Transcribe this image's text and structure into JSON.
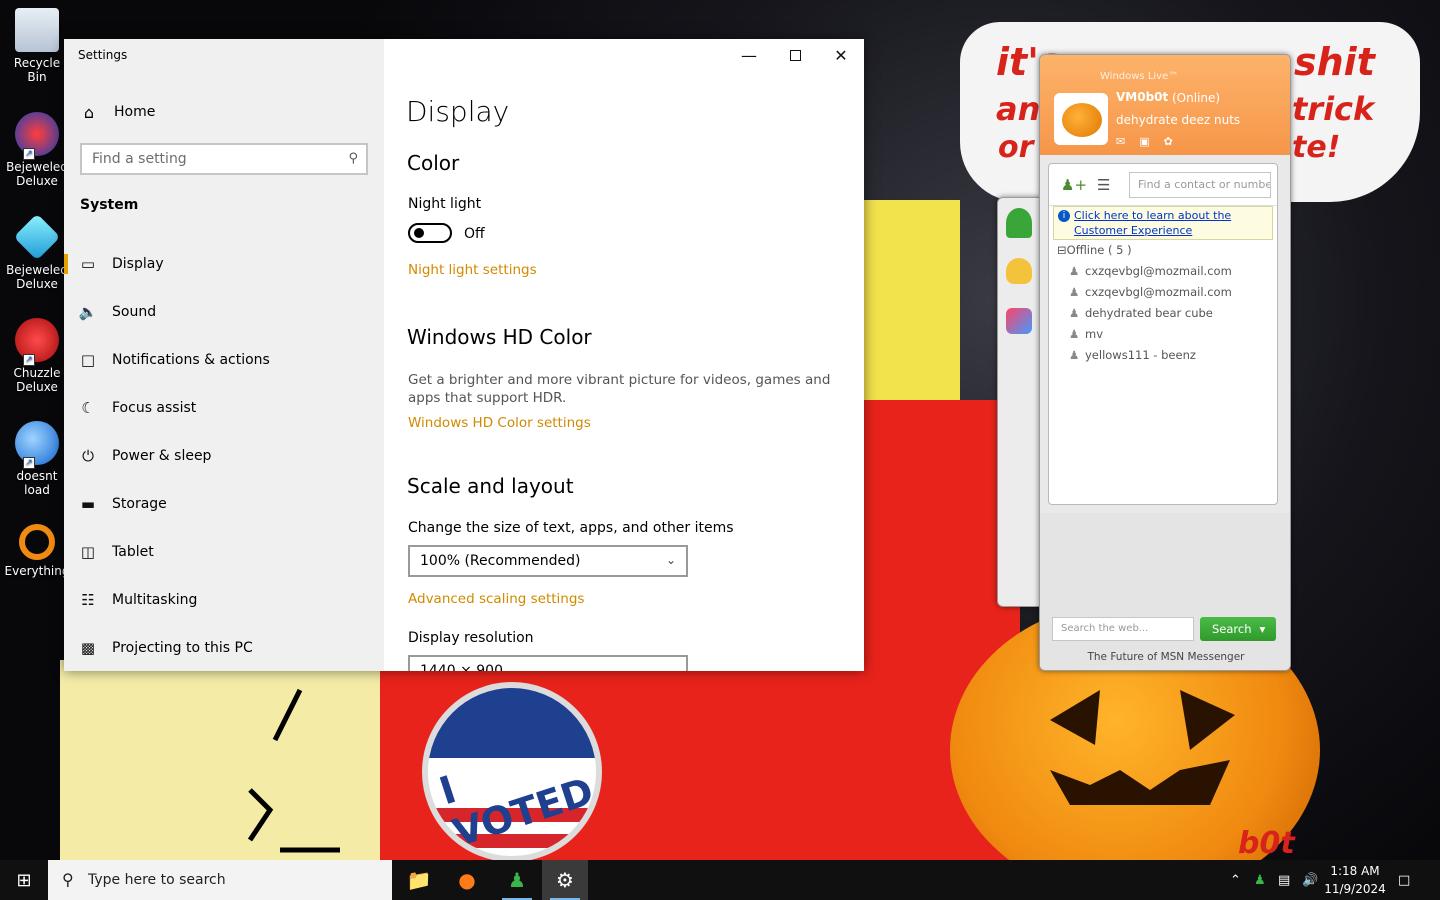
{
  "wallpaper": {
    "bubble_lines": [
      "it's",
      "shit",
      "an",
      "trick",
      "or",
      "te!"
    ],
    "badge_text": "I VOTED",
    "watermark": "b0t"
  },
  "desktop_icons": [
    {
      "label": "Recycle Bin",
      "icon": "recycle-bin-icon"
    },
    {
      "label": "Bejeweled Deluxe",
      "icon": "bejeweled2-icon"
    },
    {
      "label": "Bejeweled Deluxe",
      "icon": "bejeweled-gem-icon"
    },
    {
      "label": "Chuzzle Deluxe",
      "icon": "chuzzle-icon"
    },
    {
      "label": "doesnt load",
      "icon": "thunderbird-icon"
    },
    {
      "label": "Everything",
      "icon": "everything-search-icon"
    }
  ],
  "settings": {
    "window_title": "Settings",
    "home": "Home",
    "search_placeholder": "Find a setting",
    "section": "System",
    "nav": [
      {
        "label": "Display",
        "icon": "monitor-icon",
        "active": true
      },
      {
        "label": "Sound",
        "icon": "speaker-icon"
      },
      {
        "label": "Notifications & actions",
        "icon": "notification-icon"
      },
      {
        "label": "Focus assist",
        "icon": "moon-icon"
      },
      {
        "label": "Power & sleep",
        "icon": "power-icon"
      },
      {
        "label": "Storage",
        "icon": "storage-icon"
      },
      {
        "label": "Tablet",
        "icon": "tablet-icon"
      },
      {
        "label": "Multitasking",
        "icon": "multitasking-icon"
      },
      {
        "label": "Projecting to this PC",
        "icon": "projector-icon"
      }
    ],
    "page_title": "Display",
    "color_heading": "Color",
    "night_light_label": "Night light",
    "night_light_state": "Off",
    "night_light_link": "Night light settings",
    "hdr_heading": "Windows HD Color",
    "hdr_desc": "Get a brighter and more vibrant picture for videos, games and apps that support HDR.",
    "hdr_link": "Windows HD Color settings",
    "scale_heading": "Scale and layout",
    "scale_label": "Change the size of text, apps, and other items",
    "scale_value": "100% (Recommended)",
    "advanced_link": "Advanced scaling settings",
    "resolution_label": "Display resolution",
    "resolution_value": "1440 × 900"
  },
  "messenger": {
    "brand": "Windows Live™",
    "user_name": "VM0b0t",
    "status": "(Online)",
    "personal_message": "dehydrate deez nuts",
    "find_placeholder": "Find a contact or number",
    "banner_text": "Click here to learn about the Customer Experience",
    "group_label": "Offline ( 5 )",
    "contacts": [
      "cxzqevbgl@mozmail.com",
      "cxzqevbgl@mozmail.com",
      "dehydrated bear cube",
      "mv",
      "yellows111 - beenz"
    ],
    "web_search_placeholder": "Search the web...",
    "search_button": "Search",
    "footer": "The Future of MSN Messenger"
  },
  "taskbar": {
    "search_placeholder": "Type here to search",
    "time": "1:18 AM",
    "date": "11/9/2024",
    "apps": [
      {
        "name": "file-explorer",
        "icon": "folder-icon",
        "running": false
      },
      {
        "name": "firefox",
        "icon": "firefox-icon",
        "running": false
      },
      {
        "name": "messenger",
        "icon": "messenger-buddy-icon",
        "running": true
      },
      {
        "name": "settings",
        "icon": "gear-icon",
        "running": true,
        "active": true
      }
    ]
  }
}
